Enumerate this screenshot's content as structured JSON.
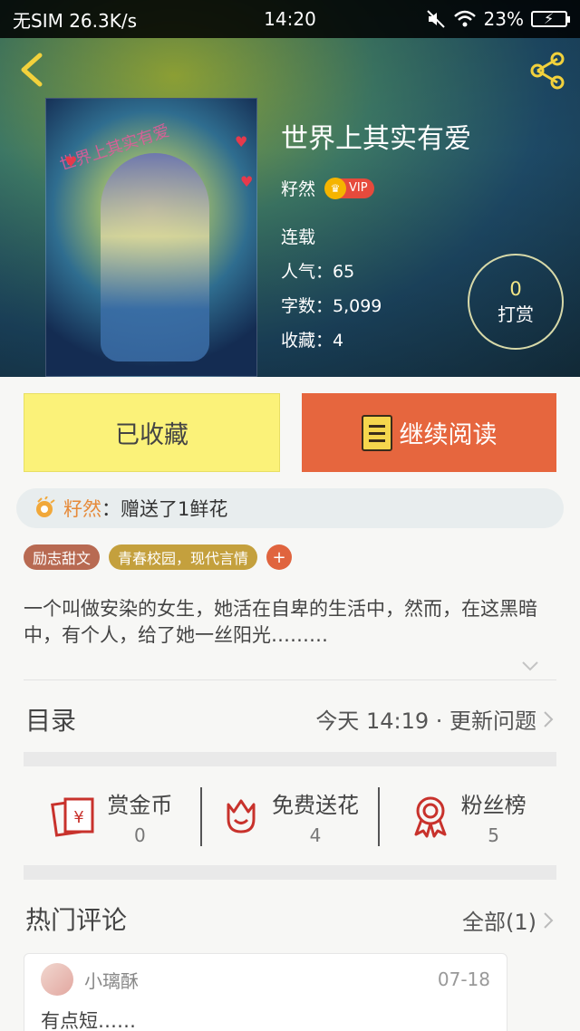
{
  "status_bar": {
    "carrier": "无SIM 26.3K/s",
    "time": "14:20",
    "battery": "23%"
  },
  "book": {
    "title": "世界上其实有爱",
    "author": "籽然",
    "vip_label": "VIP",
    "status": "连载",
    "popularity": "人气：65",
    "word_count": "字数：5,099",
    "favorites": "收藏：4",
    "cover_watermark": "世界上其实有爱"
  },
  "tip": {
    "count": "0",
    "label": "打赏"
  },
  "actions": {
    "favorited_label": "已收藏",
    "continue_label": "继续阅读"
  },
  "gift_notice": {
    "who": "籽然",
    "text": "：赠送了1鲜花"
  },
  "tags": [
    "励志甜文",
    "青春校园，现代言情"
  ],
  "tag_add": "+",
  "description": "一个叫做安染的女生，她活在自卑的生活中，然而，在这黑暗中，有个人，给了她一丝阳光………",
  "catalog": {
    "title": "目录",
    "update": "今天 14:19 · 更新问题"
  },
  "stats": [
    {
      "name": "赏金币",
      "value": "0",
      "icon": "red-envelope-icon"
    },
    {
      "name": "免费送花",
      "value": "4",
      "icon": "flower-icon"
    },
    {
      "name": "粉丝榜",
      "value": "5",
      "icon": "award-ribbon-icon"
    }
  ],
  "comments": {
    "title": "热门评论",
    "all_link": "全部(1)",
    "items": [
      {
        "user": "小璃酥",
        "date": "07-18",
        "text": "有点短……"
      }
    ]
  },
  "colors": {
    "accent_orange": "#e6663e",
    "favorite_yellow": "#fbf279",
    "icon_red": "#c8322c"
  }
}
